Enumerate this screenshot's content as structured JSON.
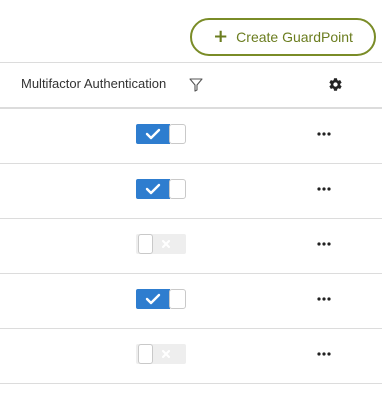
{
  "toolbar": {
    "create_button_label": "Create GuardPoint"
  },
  "table": {
    "column_header": "Multifactor Authentication",
    "rows": [
      {
        "mfa_enabled": true
      },
      {
        "mfa_enabled": true
      },
      {
        "mfa_enabled": false
      },
      {
        "mfa_enabled": true
      },
      {
        "mfa_enabled": false
      }
    ]
  },
  "icons": {
    "create": "plus-icon",
    "filter": "filter-icon",
    "settings": "gear-icon",
    "toggle_on": "checkmark-icon",
    "toggle_off": "x-icon",
    "row_actions": "more-horizontal-icon"
  },
  "colors": {
    "accent_green": "#7a8c27",
    "toggle_on_blue": "#2e7dcf",
    "toggle_off_gray": "#eeeeee",
    "divider": "#dcdcdc"
  }
}
